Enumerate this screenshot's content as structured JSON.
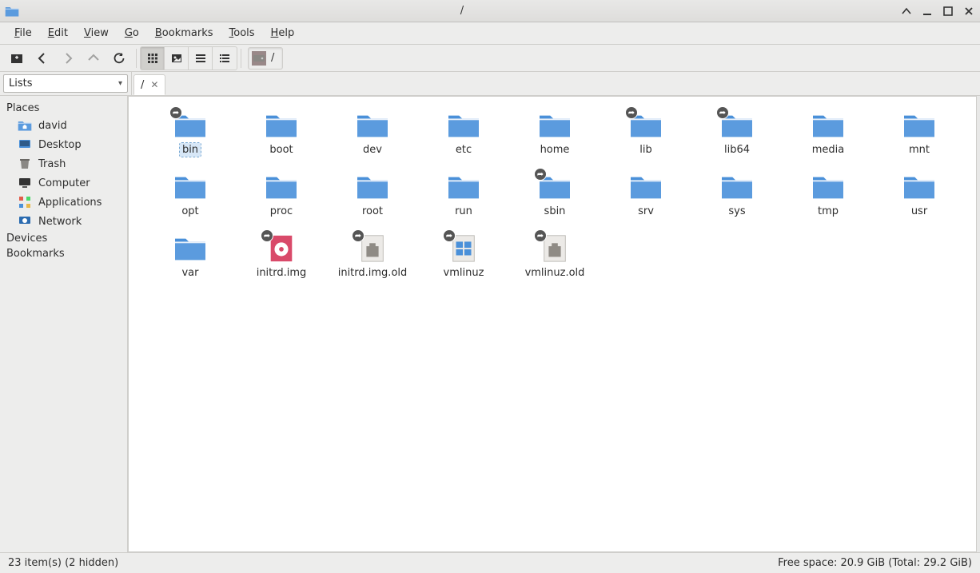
{
  "window": {
    "title": "/"
  },
  "menus": {
    "file": "File",
    "edit": "Edit",
    "view": "View",
    "go": "Go",
    "bookmarks": "Bookmarks",
    "tools": "Tools",
    "help": "Help"
  },
  "path": {
    "current": "/"
  },
  "sidebar_mode": "Lists",
  "tab": {
    "label": "/"
  },
  "sidebar": {
    "places_header": "Places",
    "devices_header": "Devices",
    "bookmarks_header": "Bookmarks",
    "places": [
      {
        "label": "david",
        "icon": "home"
      },
      {
        "label": "Desktop",
        "icon": "desktop"
      },
      {
        "label": "Trash",
        "icon": "trash"
      },
      {
        "label": "Computer",
        "icon": "computer"
      },
      {
        "label": "Applications",
        "icon": "apps"
      },
      {
        "label": "Network",
        "icon": "network"
      }
    ]
  },
  "items": [
    {
      "name": "bin",
      "type": "folder",
      "link": true,
      "selected": true
    },
    {
      "name": "boot",
      "type": "folder",
      "link": false
    },
    {
      "name": "dev",
      "type": "folder",
      "link": false
    },
    {
      "name": "etc",
      "type": "folder",
      "link": false
    },
    {
      "name": "home",
      "type": "folder",
      "link": false
    },
    {
      "name": "lib",
      "type": "folder",
      "link": true
    },
    {
      "name": "lib64",
      "type": "folder",
      "link": true
    },
    {
      "name": "media",
      "type": "folder",
      "link": false
    },
    {
      "name": "mnt",
      "type": "folder",
      "link": false
    },
    {
      "name": "opt",
      "type": "folder",
      "link": false
    },
    {
      "name": "proc",
      "type": "folder",
      "link": false
    },
    {
      "name": "root",
      "type": "folder",
      "link": false
    },
    {
      "name": "run",
      "type": "folder",
      "link": false
    },
    {
      "name": "sbin",
      "type": "folder",
      "link": true
    },
    {
      "name": "srv",
      "type": "folder",
      "link": false
    },
    {
      "name": "sys",
      "type": "folder",
      "link": false
    },
    {
      "name": "tmp",
      "type": "folder",
      "link": false
    },
    {
      "name": "usr",
      "type": "folder",
      "link": false
    },
    {
      "name": "var",
      "type": "folder",
      "link": false
    },
    {
      "name": "initrd.img",
      "type": "disk-image",
      "link": true
    },
    {
      "name": "initrd.img.old",
      "type": "file",
      "link": true
    },
    {
      "name": "vmlinuz",
      "type": "exe",
      "link": true
    },
    {
      "name": "vmlinuz.old",
      "type": "file",
      "link": true
    }
  ],
  "status": {
    "left": "23 item(s) (2 hidden)",
    "right": "Free space: 20.9 GiB (Total: 29.2 GiB)"
  }
}
